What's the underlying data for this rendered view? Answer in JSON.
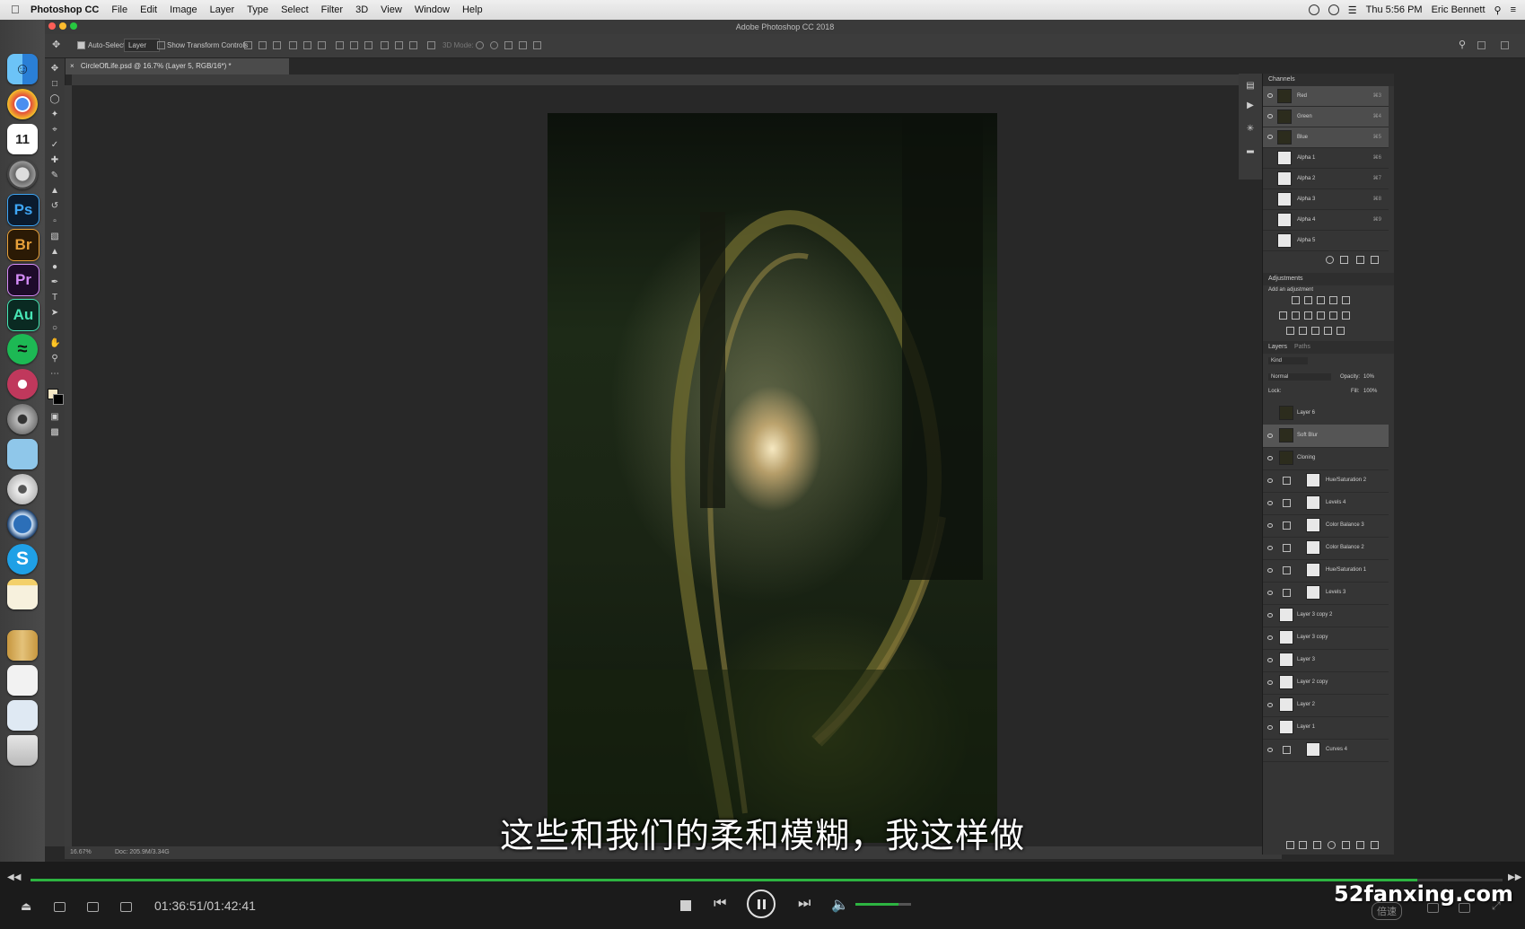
{
  "menubar": {
    "app": "Photoshop CC",
    "items": [
      "File",
      "Edit",
      "Image",
      "Layer",
      "Type",
      "Select",
      "Filter",
      "3D",
      "View",
      "Window",
      "Help"
    ],
    "clock": "Thu 5:56 PM",
    "user": "Eric Bennett"
  },
  "window": {
    "title": "Adobe Photoshop CC 2018"
  },
  "options": {
    "auto_select_label": "Auto-Select:",
    "auto_select_value": "Layer",
    "transform_label": "Show Transform Controls",
    "mode_3d": "3D Mode:"
  },
  "document": {
    "tab": "CircleOfLife.psd @ 16.7% (Layer 5, RGB/16*) *",
    "zoom": "16.67%",
    "doc_size": "Doc: 205.9M/3.34G"
  },
  "panels": {
    "channels": {
      "title": "Channels",
      "rows": [
        {
          "name": "Red",
          "shortcut": "⌘3"
        },
        {
          "name": "Green",
          "shortcut": "⌘4"
        },
        {
          "name": "Blue",
          "shortcut": "⌘5"
        },
        {
          "name": "Alpha 1",
          "shortcut": "⌘6"
        },
        {
          "name": "Alpha 2",
          "shortcut": "⌘7"
        },
        {
          "name": "Alpha 3",
          "shortcut": "⌘8"
        },
        {
          "name": "Alpha 4",
          "shortcut": "⌘9"
        },
        {
          "name": "Alpha 5",
          "shortcut": ""
        }
      ]
    },
    "adjustments": {
      "title": "Adjustments",
      "subtitle": "Add an adjustment"
    },
    "layers": {
      "tab_layers": "Layers",
      "tab_paths": "Paths",
      "filter_kind": "Kind",
      "blend_mode": "Normal",
      "opacity_label": "Opacity:",
      "opacity_value": "10%",
      "lock_label": "Lock:",
      "fill_label": "Fill:",
      "fill_value": "100%",
      "rows": [
        "Layer 6",
        "Soft Blur",
        "Cloning",
        "Hue/Saturation 2",
        "Levels 4",
        "Color Balance 3",
        "Color Balance 2",
        "Hue/Saturation 1",
        "Levels 3",
        "Layer 3 copy 2",
        "Layer 3 copy",
        "Layer 3",
        "Layer 2 copy",
        "Layer 2",
        "Layer 1",
        "Curves 4"
      ]
    }
  },
  "player": {
    "subtitle": "这些和我们的柔和模糊，我这样做",
    "time_current": "01:36:51",
    "time_total": "01:42:41",
    "progress": 0.942,
    "volume": 0.78,
    "speed_label": "倍速",
    "watermark": "52fanxing.com",
    "accent": "#2db441"
  }
}
